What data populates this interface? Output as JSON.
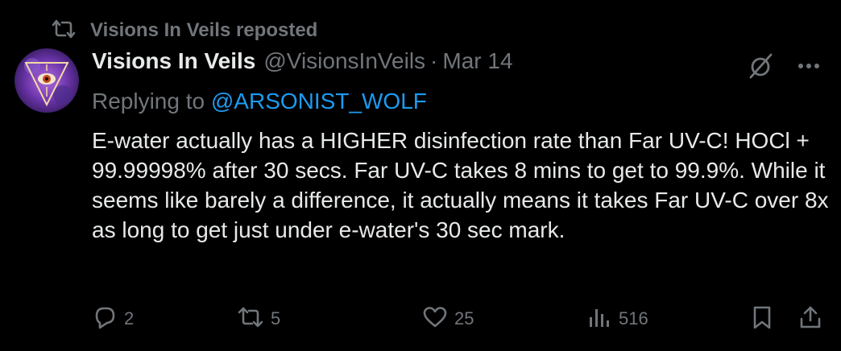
{
  "repost": {
    "label": "Visions In Veils reposted",
    "icon": "repost-icon"
  },
  "author": {
    "display_name": "Visions In Veils",
    "handle": "@VisionsInVeils",
    "separator": "·",
    "date": "Mar 14"
  },
  "reply": {
    "prefix": "Replying to ",
    "handle": "@ARSONIST_WOLF"
  },
  "tweet": {
    "text": "E-water actually has a HIGHER disinfection rate than Far UV-C! HOCl + 99.99998% after 30 secs. Far UV-C takes 8 mins to get to 99.9%. While it seems like barely a difference, it actually means it takes Far UV-C over 8x as long to get just under e-water's 30 sec mark."
  },
  "actions": {
    "replies": "2",
    "reposts": "5",
    "likes": "25",
    "views": "516"
  },
  "colors": {
    "background": "#000000",
    "text": "#e7e9ea",
    "muted": "#71767b",
    "link": "#1d9bf0"
  }
}
